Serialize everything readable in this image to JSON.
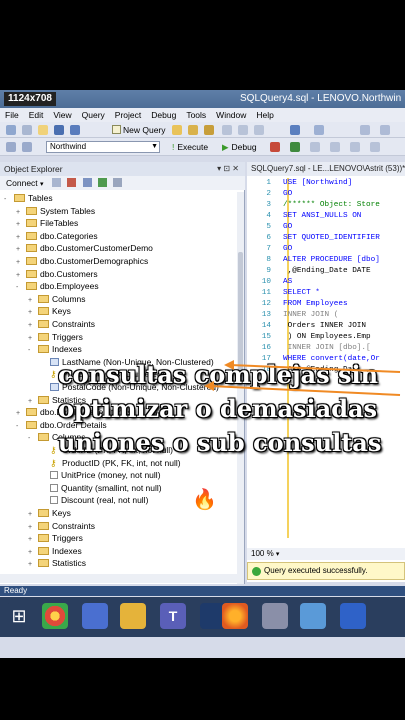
{
  "window": {
    "size_badge": "1124x708",
    "title": "SQLQuery4.sql - LENOVO.Northwin"
  },
  "menu": [
    "File",
    "Edit",
    "View",
    "Query",
    "Project",
    "Debug",
    "Tools",
    "Window",
    "Help"
  ],
  "toolbar": {
    "new_query": "New Query",
    "database": "Northwind",
    "execute": "Execute",
    "debug": "Debug"
  },
  "object_explorer": {
    "title": "Object Explorer",
    "connect": "Connect",
    "tree": [
      {
        "label": "Tables",
        "kind": "folder",
        "level": 0,
        "exp": "-"
      },
      {
        "label": "System Tables",
        "kind": "folder",
        "level": 1,
        "exp": "+"
      },
      {
        "label": "FileTables",
        "kind": "folder",
        "level": 1,
        "exp": "+"
      },
      {
        "label": "dbo.Categories",
        "kind": "folder",
        "level": 1,
        "exp": "+"
      },
      {
        "label": "dbo.CustomerCustomerDemo",
        "kind": "folder",
        "level": 1,
        "exp": "+"
      },
      {
        "label": "dbo.CustomerDemographics",
        "kind": "folder",
        "level": 1,
        "exp": "+"
      },
      {
        "label": "dbo.Customers",
        "kind": "folder",
        "level": 1,
        "exp": "+"
      },
      {
        "label": "dbo.Employees",
        "kind": "folder",
        "level": 1,
        "exp": "-"
      },
      {
        "label": "Columns",
        "kind": "folder",
        "level": 2,
        "exp": "+"
      },
      {
        "label": "Keys",
        "kind": "folder",
        "level": 2,
        "exp": "+"
      },
      {
        "label": "Constraints",
        "kind": "folder",
        "level": 2,
        "exp": "+"
      },
      {
        "label": "Triggers",
        "kind": "folder",
        "level": 2,
        "exp": "+"
      },
      {
        "label": "Indexes",
        "kind": "folder",
        "level": 2,
        "exp": "-"
      },
      {
        "label": "LastName (Non-Unique, Non-Clustered)",
        "kind": "idx",
        "level": 3,
        "exp": ""
      },
      {
        "label": "PK_Employees (Clustered)",
        "kind": "key",
        "level": 3,
        "exp": ""
      },
      {
        "label": "PostalCode (Non-Unique, Non-Clustered)",
        "kind": "idx",
        "level": 3,
        "exp": ""
      },
      {
        "label": "Statistics",
        "kind": "folder",
        "level": 2,
        "exp": "+"
      },
      {
        "label": "dbo.EmployeeTerritories",
        "kind": "folder",
        "level": 1,
        "exp": "+"
      },
      {
        "label": "dbo.Order Details",
        "kind": "folder",
        "level": 1,
        "exp": "-"
      },
      {
        "label": "Columns",
        "kind": "folder",
        "level": 2,
        "exp": "-"
      },
      {
        "label": "OrderID (PK, FK, int, not null)",
        "kind": "key",
        "level": 3,
        "exp": ""
      },
      {
        "label": "ProductID (PK, FK, int, not null)",
        "kind": "key",
        "level": 3,
        "exp": ""
      },
      {
        "label": "UnitPrice (money, not null)",
        "kind": "col",
        "level": 3,
        "exp": ""
      },
      {
        "label": "Quantity (smallint, not null)",
        "kind": "col",
        "level": 3,
        "exp": ""
      },
      {
        "label": "Discount (real, not null)",
        "kind": "col",
        "level": 3,
        "exp": ""
      },
      {
        "label": "Keys",
        "kind": "folder",
        "level": 2,
        "exp": "+"
      },
      {
        "label": "Constraints",
        "kind": "folder",
        "level": 2,
        "exp": "+"
      },
      {
        "label": "Triggers",
        "kind": "folder",
        "level": 2,
        "exp": "+"
      },
      {
        "label": "Indexes",
        "kind": "folder",
        "level": 2,
        "exp": "+"
      },
      {
        "label": "Statistics",
        "kind": "folder",
        "level": 2,
        "exp": "+"
      }
    ]
  },
  "query_tab": {
    "title": "SQLQuery7.sql - LE...LENOVO\\Astrit (53))*"
  },
  "code": [
    {
      "n": "1",
      "t": "USE [Northwind]",
      "c": "kw"
    },
    {
      "n": "2",
      "t": "GO",
      "c": "kw"
    },
    {
      "n": "3",
      "t": "/****** Object:  Store",
      "c": "cm"
    },
    {
      "n": "4",
      "t": "SET ANSI_NULLS ON",
      "c": "kw"
    },
    {
      "n": "5",
      "t": "GO",
      "c": "kw"
    },
    {
      "n": "6",
      "t": "SET QUOTED_IDENTIFIER",
      "c": "kw"
    },
    {
      "n": "7",
      "t": "GO",
      "c": "kw"
    },
    {
      "n": "8",
      "t": "ALTER PROCEDURE [dbo]",
      "c": "kw"
    },
    {
      "n": "9",
      "t": "    ,@Ending_Date DATE",
      "c": "tx"
    },
    {
      "n": "10",
      "t": "AS",
      "c": "kw"
    },
    {
      "n": "11",
      "t": "SELECT *",
      "c": "kw"
    },
    {
      "n": "12",
      "t": "FROM Employees",
      "c": "kw"
    },
    {
      "n": "13",
      "t": "INNER JOIN (",
      "c": "gr"
    },
    {
      "n": "14",
      "t": "    Orders INNER JOIN",
      "c": "tx"
    },
    {
      "n": "15",
      "t": "    ) ON Employees.Emp",
      "c": "tx"
    },
    {
      "n": "16",
      "t": "    INNER JOIN [dbo].[",
      "c": "gr"
    },
    {
      "n": "17",
      "t": "WHERE convert(date,Or",
      "c": "kw"
    },
    {
      "n": "18",
      "t": "        AND @Ending_Da",
      "c": "tx"
    }
  ],
  "zoom": "100 %",
  "status_message": "Query executed successfully.",
  "ready": "Ready",
  "overlay_lines": [
    "consultas complejas sin",
    "optimizar o demasiadas",
    "uniones o sub consultas"
  ],
  "fire_emoji": "🔥",
  "colors": {
    "accent_arrow": "#f08a24",
    "title_bar": "#5f7fa8",
    "status_ok": "#3aa83a"
  }
}
